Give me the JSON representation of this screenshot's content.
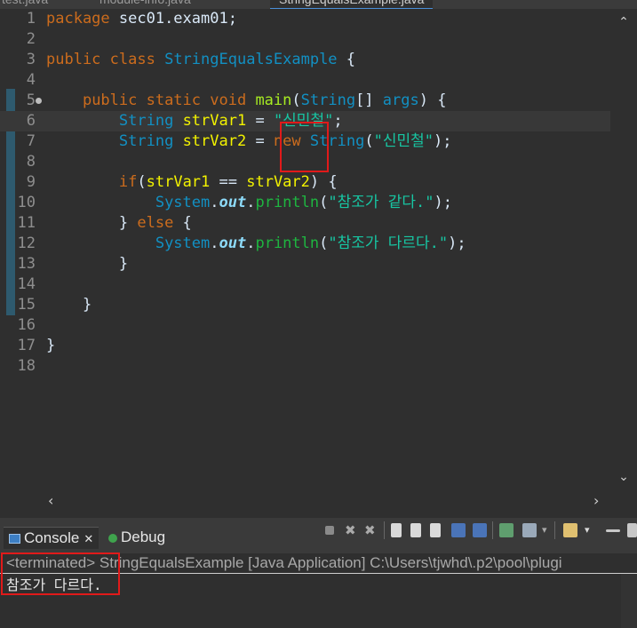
{
  "tabs": [
    "test.java",
    "module-info.java",
    "StringEqualsExample.java"
  ],
  "editor": {
    "lines": [
      {
        "n": "1",
        "code": "package sec01.exam01;"
      },
      {
        "n": "2",
        "code": ""
      },
      {
        "n": "3",
        "code": "public class StringEqualsExample {"
      },
      {
        "n": "4",
        "code": ""
      },
      {
        "n": "5",
        "code": "    public static void main(String[] args) {"
      },
      {
        "n": "6",
        "code": "        String strVar1 = \"신민철\";"
      },
      {
        "n": "7",
        "code": "        String strVar2 = new String(\"신민철\");"
      },
      {
        "n": "8",
        "code": ""
      },
      {
        "n": "9",
        "code": "        if(strVar1 == strVar2) {"
      },
      {
        "n": "10",
        "code": "            System.out.println(\"참조가 같다.\");"
      },
      {
        "n": "11",
        "code": "        } else {"
      },
      {
        "n": "12",
        "code": "            System.out.println(\"참조가 다르다.\");"
      },
      {
        "n": "13",
        "code": "        }"
      },
      {
        "n": "14",
        "code": ""
      },
      {
        "n": "15",
        "code": "    }"
      },
      {
        "n": "16",
        "code": ""
      },
      {
        "n": "17",
        "code": "}"
      },
      {
        "n": "18",
        "code": ""
      }
    ]
  },
  "console": {
    "tab_console": "Console",
    "tab_debug": "Debug",
    "terminated": "<terminated> StringEqualsExample [Java Application] C:\\Users\\tjwhd\\.p2\\pool\\plugi",
    "output": "참조가 다르다."
  },
  "colors": {
    "keyword": "#cc6c1d",
    "type": "#1290c3",
    "string": "#17c6a3",
    "highlight": "#e11a1a"
  }
}
